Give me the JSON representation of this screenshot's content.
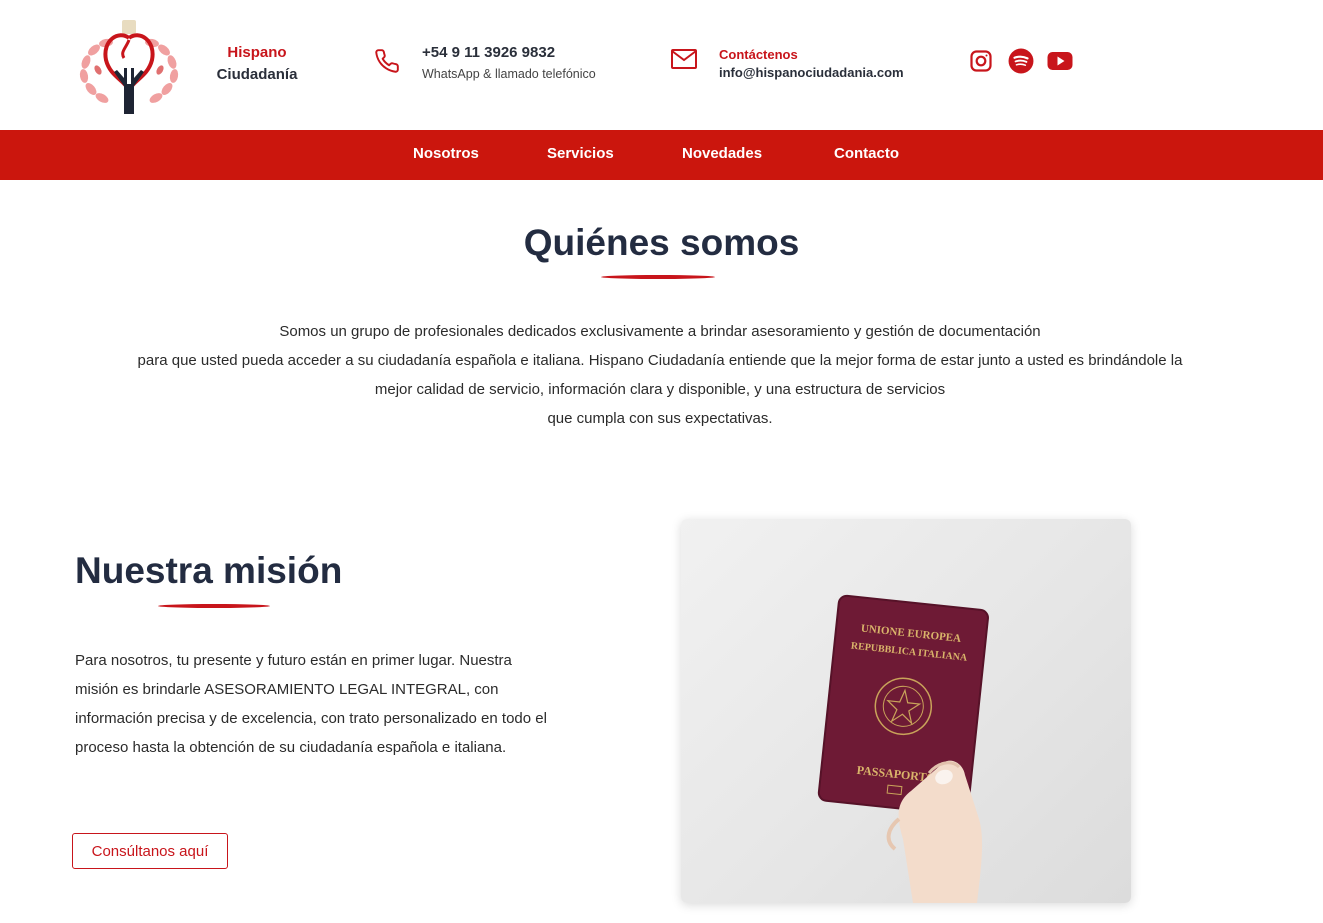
{
  "header": {
    "brand": {
      "line1": "Hispano",
      "line2": "Ciudadanía"
    },
    "phone": {
      "number": "+54 9 11 3926 9832",
      "subtitle": "WhatsApp & llamado telefónico"
    },
    "email": {
      "title": "Contáctenos",
      "address": "info@hispanociudadania.com"
    },
    "social": [
      "instagram-icon",
      "spotify-icon",
      "youtube-icon"
    ]
  },
  "nav": {
    "items": [
      "Nosotros",
      "Servicios",
      "Novedades",
      "Contacto"
    ]
  },
  "about": {
    "title": "Quiénes somos",
    "lines": [
      "Somos un grupo de profesionales dedicados exclusivamente a brindar asesoramiento y gestión de documentación",
      "para que usted pueda acceder a su ciudadanía española e italiana. Hispano Ciudadanía entiende que la mejor forma de estar junto a usted es brindándole la",
      "mejor calidad de servicio, información clara y disponible, y una estructura de servicios",
      "que cumpla con sus expectativas."
    ]
  },
  "mission": {
    "title": "Nuestra misión",
    "text": "Para nosotros, tu presente y futuro están en primer lugar. Nuestra misión es brindarle ASESORAMIENTO LEGAL INTEGRAL, con información precisa y de excelencia, con trato personalizado en todo el proceso hasta la obtención de su ciudadanía española e italiana.",
    "button_label": "Consúltanos aquí"
  },
  "photo": {
    "passport_line1": "UNIONE EUROPEA",
    "passport_line2": "REPUBBLICA ITALIANA",
    "passport_line3": "PASSAPORTO"
  },
  "colors": {
    "accent": "#cb160d",
    "heading": "#232c41",
    "passport": "#6e1a35"
  }
}
